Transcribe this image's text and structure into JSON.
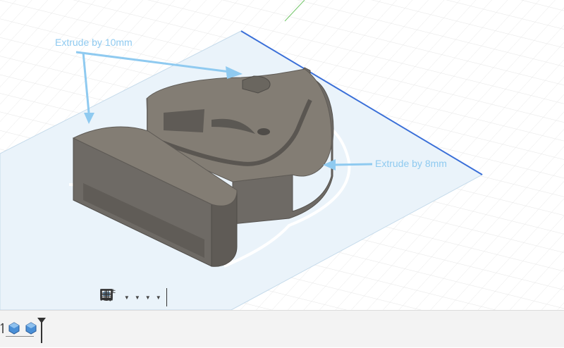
{
  "annotations": {
    "extrude_10": "Extrude by 10mm",
    "extrude_8": "Extrude by 8mm"
  },
  "colors": {
    "annotation": "#8fcaf0",
    "body_top": "#837d74",
    "body_side": "#6e6a65",
    "sketch_plane": "#eaf3fa",
    "axis_blue": "#3a6fd8",
    "axis_green": "#74c66a"
  },
  "toolbar": {
    "items": [
      "orbit-icon",
      "look-at-icon",
      "pan-icon",
      "zoom-icon",
      "fit-icon",
      "display-settings-icon",
      "grid-settings-icon",
      "viewports-icon"
    ]
  },
  "timeline": {
    "items": [
      "extrude-feature-icon",
      "extrude-feature-icon",
      "timeline-marker-icon"
    ]
  }
}
